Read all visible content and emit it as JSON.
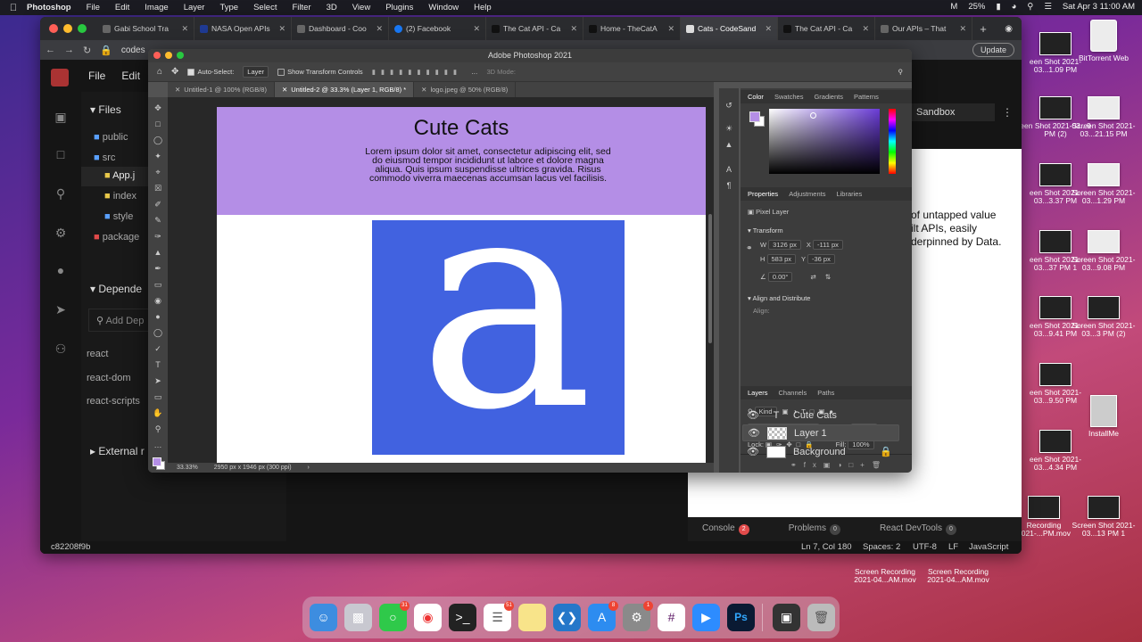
{
  "menubar": {
    "app": "Photoshop",
    "items": [
      "File",
      "Edit",
      "Image",
      "Layer",
      "Type",
      "Select",
      "Filter",
      "3D",
      "View",
      "Plugins",
      "Window",
      "Help"
    ],
    "battery": "25%",
    "datetime": "Sat Apr 3  11:00 AM"
  },
  "browser": {
    "tabs": [
      {
        "label": "Gabi School Tra",
        "active": false
      },
      {
        "label": "NASA Open APIs",
        "active": false
      },
      {
        "label": "Dashboard - Coo",
        "active": false
      },
      {
        "label": "(2) Facebook",
        "active": false
      },
      {
        "label": "The Cat API - Ca",
        "active": false
      },
      {
        "label": "Home - TheCatA",
        "active": false
      },
      {
        "label": "Cats - CodeSand",
        "active": true
      },
      {
        "label": "The Cat API - Ca",
        "active": false
      },
      {
        "label": "Our APIs – That",
        "active": false
      }
    ],
    "url": "codes",
    "update_label": "Update"
  },
  "codesandbox": {
    "menu": [
      "File",
      "Edit"
    ],
    "files_header": "Files",
    "files": [
      {
        "name": "public",
        "kind": "folder"
      },
      {
        "name": "src",
        "kind": "folder"
      },
      {
        "name": "App.j",
        "kind": "js"
      },
      {
        "name": "index",
        "kind": "js"
      },
      {
        "name": "style",
        "kind": "css"
      },
      {
        "name": "package",
        "kind": "json"
      }
    ],
    "dependencies_header": "Depende",
    "add_dependency_placeholder": "Add Dep",
    "dependencies": [
      "react",
      "react-dom",
      "react-scripts"
    ],
    "external_header": "External r",
    "sandbox_label": "Sandbox",
    "preview_lines": [
      "of untapped value",
      "ilt APIs, easily",
      "derpinned by Data."
    ],
    "console_tabs": [
      {
        "label": "Console",
        "count": "2"
      },
      {
        "label": "Problems",
        "count": "0"
      },
      {
        "label": "React DevTools",
        "count": "0"
      }
    ],
    "status_left": "c82208f9b",
    "status_right": [
      "Ln 7, Col 180",
      "Spaces: 2",
      "UTF-8",
      "LF",
      "JavaScript"
    ]
  },
  "photoshop": {
    "title": "Adobe Photoshop 2021",
    "options": {
      "auto_select_label": "Auto-Select:",
      "auto_select_value": "Layer",
      "show_transform_label": "Show Transform Controls",
      "mode_3d": "3D Mode:"
    },
    "doc_tabs": [
      {
        "label": "Untitled-1 @ 100% (RGB/8)",
        "active": false
      },
      {
        "label": "Untitled-2 @ 33.3% (Layer 1, RGB/8) *",
        "active": true
      },
      {
        "label": "logo.jpeg @ 50% (RGB/8)",
        "active": false
      }
    ],
    "document": {
      "title": "Cute Cats",
      "body": "Lorem ipsum dolor sit amet, consectetur adipiscing elit, sed do eiusmod tempor incididunt ut labore et dolore magna aliqua. Quis ipsum suspendisse ultrices gravida. Risus commodo viverra maecenas accumsan lacus vel facilisis.",
      "image_letter": "a",
      "header_color": "#b48ee6",
      "image_bg_color": "#4162e0"
    },
    "status": {
      "zoom": "33.33%",
      "info": "2950 px x 1946 px (300 ppi)"
    },
    "panels": {
      "color_tabs": [
        "Color",
        "Swatches",
        "Gradients",
        "Patterns"
      ],
      "properties_tabs": [
        "Properties",
        "Adjustments",
        "Libraries"
      ],
      "pixel_layer": "Pixel Layer",
      "transform_label": "Transform",
      "w": "3126 px",
      "h": "583 px",
      "x": "-111 px",
      "y": "-36 px",
      "angle": "0.00°",
      "align_label": "Align and Distribute",
      "align_sub": "Align:",
      "layers_tabs": [
        "Layers",
        "Channels",
        "Paths"
      ],
      "kind_label": "Kind",
      "blend_mode": "Normal",
      "opacity_label": "Opacity:",
      "opacity": "100%",
      "lock_label": "Lock:",
      "fill_label": "Fill:",
      "fill": "100%",
      "layers": [
        {
          "name": "Cute Cats",
          "type": "text",
          "selected": false
        },
        {
          "name": "Layer 1",
          "type": "pixel",
          "selected": true
        },
        {
          "name": "Background",
          "type": "background",
          "selected": false
        }
      ]
    }
  },
  "desktop_icons": [
    {
      "label": "een Shot 2021-03...1.09 PM"
    },
    {
      "label": "BitTorrent Web"
    },
    {
      "label": "een Shot 2021-03...9 PM (2)"
    },
    {
      "label": "Screen Shot 2021-03...21.15 PM"
    },
    {
      "label": "een Shot 2021-03...3.37 PM"
    },
    {
      "label": "Screen Shot 2021-03...1.29 PM"
    },
    {
      "label": "een Shot 2021-03...37 PM 1"
    },
    {
      "label": "Screen Shot 2021-03...9.08 PM"
    },
    {
      "label": "een Shot 2021-03...9.41 PM"
    },
    {
      "label": "Screen Shot 2021-03...3 PM (2)"
    },
    {
      "label": "een Shot 2021-03...9.50 PM"
    },
    {
      "label": "InstallMe"
    },
    {
      "label": "een Shot 2021-03...4.34 PM"
    },
    {
      "label": "Recording 2021-...PM.mov"
    },
    {
      "label": "Screen Shot 2021-03...13 PM 1"
    },
    {
      "label": "Screen Recording 2021-04...AM.mov"
    },
    {
      "label": "Screen Recording 2021-04...AM.mov"
    }
  ],
  "dock": [
    {
      "name": "finder",
      "badge": ""
    },
    {
      "name": "launchpad",
      "badge": ""
    },
    {
      "name": "messages",
      "badge": "31"
    },
    {
      "name": "chrome",
      "badge": ""
    },
    {
      "name": "terminal",
      "badge": ""
    },
    {
      "name": "reminders",
      "badge": "51"
    },
    {
      "name": "notes",
      "badge": ""
    },
    {
      "name": "vscode",
      "badge": ""
    },
    {
      "name": "app-store",
      "badge": "8"
    },
    {
      "name": "system-preferences",
      "badge": "1"
    },
    {
      "name": "slack",
      "badge": ""
    },
    {
      "name": "zoom",
      "badge": ""
    },
    {
      "name": "photoshop",
      "badge": ""
    },
    {
      "name": "screen-capture",
      "badge": ""
    },
    {
      "name": "trash",
      "badge": ""
    }
  ]
}
